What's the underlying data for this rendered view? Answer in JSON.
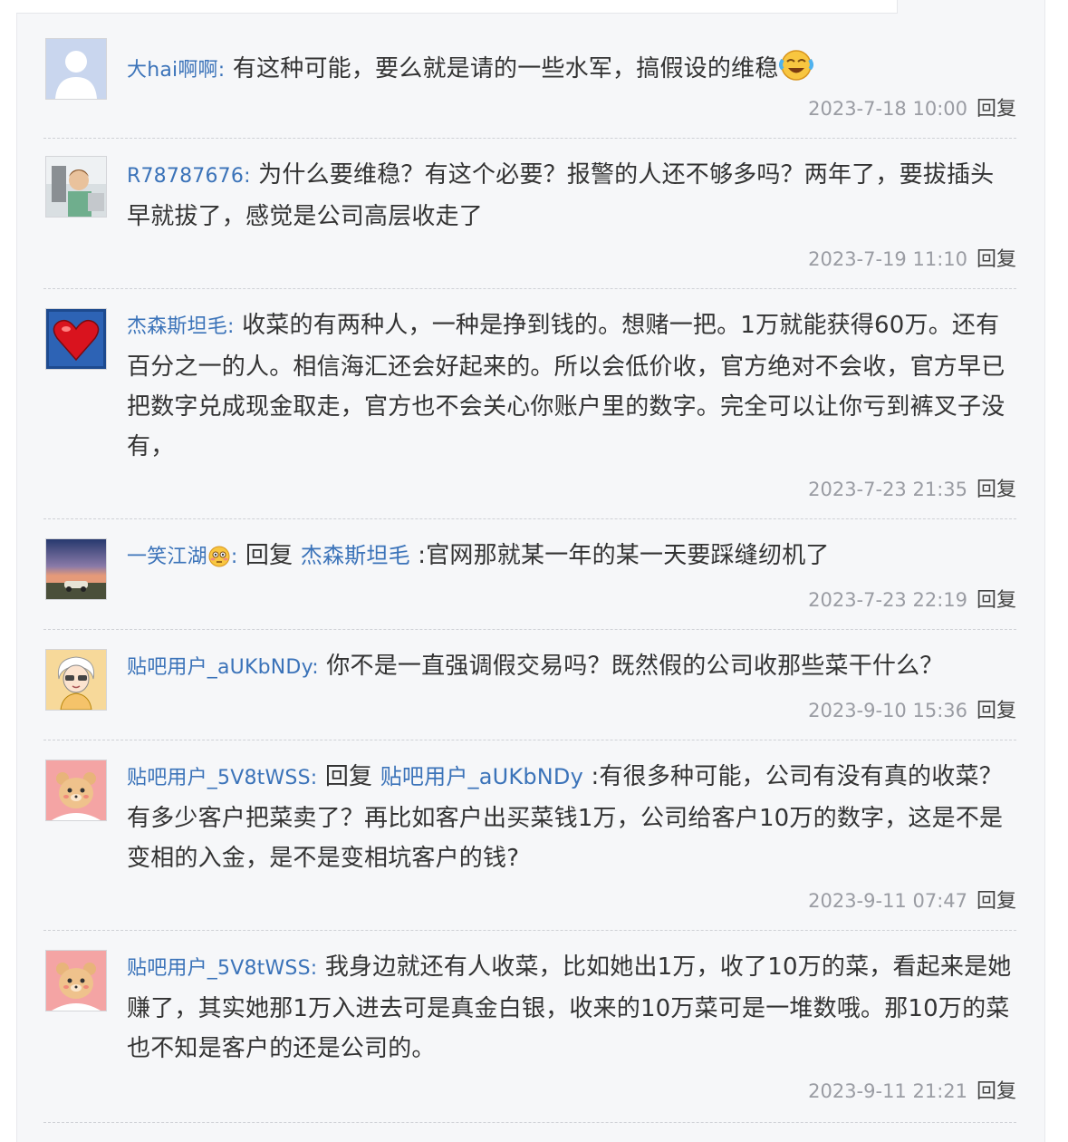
{
  "comments": [
    {
      "user": "大hai啊啊",
      "avatar_icon": "default-user-avatar",
      "text": "有这种可能，要么就是请的一些水军，搞假设的维稳",
      "emoji": "crying-laughing-emoji",
      "time": "2023-7-18 10:00",
      "reply_label": "回复"
    },
    {
      "user": "R78787676",
      "avatar_icon": "child-photo-avatar",
      "text": "为什么要维稳？有这个必要？报警的人还不够多吗？两年了，要拔插头早就拔了，感觉是公司高层收走了",
      "time": "2023-7-19 11:10",
      "reply_label": "回复"
    },
    {
      "user": "杰森斯坦毛",
      "avatar_icon": "red-heart-avatar",
      "text": "收菜的有两种人，一种是挣到钱的。想赌一把。1万就能获得60万。还有百分之一的人。相信海汇还会好起来的。所以会低价收，官方绝对不会收，官方早已把数字兑成现金取走，官方也不会关心你账户里的数字。完全可以让你亏到裤叉子没有，",
      "time": "2023-7-23 21:35",
      "reply_label": "回复"
    },
    {
      "user": "一笑江湖",
      "avatar_icon": "sunset-car-avatar",
      "emoji": "flushed-emoji",
      "reply_word": "回复",
      "reply_target": "杰森斯坦毛",
      "text": ":官网那就某一年的某一天要踩缝纫机了",
      "time": "2023-7-23 22:19",
      "reply_label": "回复"
    },
    {
      "user": "贴吧用户_aUKbNDy",
      "avatar_icon": "cartoon-person-avatar",
      "text": "你不是一直强调假交易吗？既然假的公司收那些菜干什么？",
      "time": "2023-9-10 15:36",
      "reply_label": "回复"
    },
    {
      "user": "贴吧用户_5V8tWSS",
      "avatar_icon": "cartoon-bear-avatar",
      "reply_word": "回复",
      "reply_target": "贴吧用户_aUKbNDy",
      "text": ":有很多种可能，公司有没有真的收菜？有多少客户把菜卖了？再比如客户出买菜钱1万，公司给客户10万的数字，这是不是变相的入金，是不是变相坑客户的钱?",
      "time": "2023-9-11 07:47",
      "reply_label": "回复"
    },
    {
      "user": "贴吧用户_5V8tWSS",
      "avatar_icon": "cartoon-bear-avatar",
      "text": "我身边就还有人收菜，比如她出1万，收了10万的菜，看起来是她赚了，其实她那1万入进去可是真金白银，收来的10万菜可是一堆数哦。那10万的菜也不知是客户的还是公司的。",
      "time": "2023-9-11 21:21",
      "reply_label": "回复"
    }
  ]
}
